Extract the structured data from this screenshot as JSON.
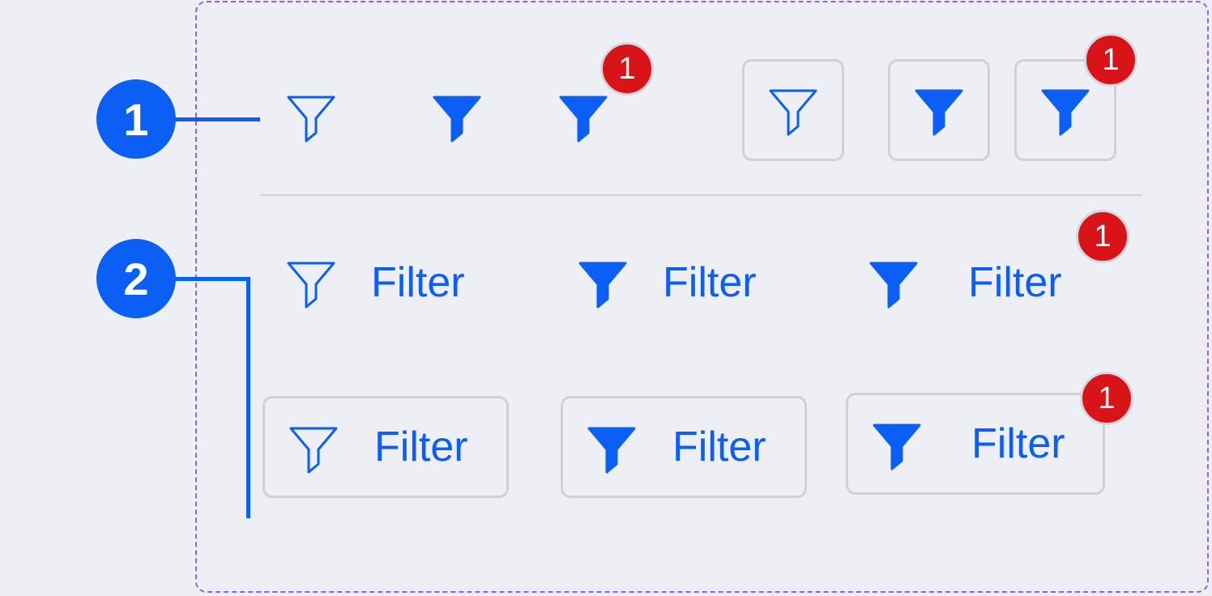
{
  "colors": {
    "accent": "#0b5ff5",
    "badge": "#d81418",
    "frame_border": "#9a5cf2",
    "control_border": "#cfd1d8",
    "background": "#eeeff5"
  },
  "callouts": [
    {
      "label": "1"
    },
    {
      "label": "2"
    }
  ],
  "icon_only_row": {
    "items": [
      {
        "icon": "filter-outline-icon",
        "badge": ""
      },
      {
        "icon": "filter-filled-icon",
        "badge": ""
      },
      {
        "icon": "filter-filled-icon",
        "badge": "1"
      },
      {
        "icon": "filter-outline-icon",
        "badge": "",
        "bordered": true
      },
      {
        "icon": "filter-filled-icon",
        "badge": "",
        "bordered": true
      },
      {
        "icon": "filter-filled-icon",
        "badge": "1",
        "bordered": true
      }
    ]
  },
  "text_row": {
    "items": [
      {
        "icon": "filter-outline-icon",
        "label": "Filter",
        "badge": ""
      },
      {
        "icon": "filter-filled-icon",
        "label": "Filter",
        "badge": ""
      },
      {
        "icon": "filter-filled-icon",
        "label": "Filter",
        "badge": "1"
      }
    ]
  },
  "bordered_text_row": {
    "items": [
      {
        "icon": "filter-outline-icon",
        "label": "Filter",
        "badge": ""
      },
      {
        "icon": "filter-filled-icon",
        "label": "Filter",
        "badge": ""
      },
      {
        "icon": "filter-filled-icon",
        "label": "Filter",
        "badge": "1"
      }
    ]
  }
}
